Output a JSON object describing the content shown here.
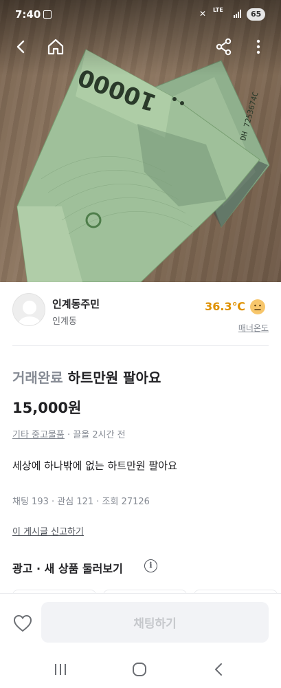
{
  "status_bar": {
    "time": "7:40",
    "network": "LTE",
    "battery": "65"
  },
  "top_nav": {
    "icons": [
      "back-icon",
      "home-icon",
      "share-icon",
      "more-icon"
    ]
  },
  "seller": {
    "name": "인계동주민",
    "area": "인계동",
    "manner_temp": "36.3℃",
    "manner_label": "매너온도",
    "manner_color": "#df9100"
  },
  "post": {
    "status": "거래완료",
    "title": "하트만원 팔아요",
    "price": "15,000원",
    "category": "기타 중고물품",
    "time": " · 끌올 2시간 전",
    "body": "세상에 하나밖에 없는 하트만원 팔아요",
    "stats": "채팅 193 · 관심 121 · 조회 27126",
    "report_link": "이 게시글 신고하기"
  },
  "ad_section": {
    "title": "광고 · 새 상품 둘러보기"
  },
  "bottom_bar": {
    "chat_button": "채팅하기"
  },
  "colors": {
    "accent": "#ff6f0f",
    "temp": "#df9100",
    "muted": "#868b94"
  }
}
